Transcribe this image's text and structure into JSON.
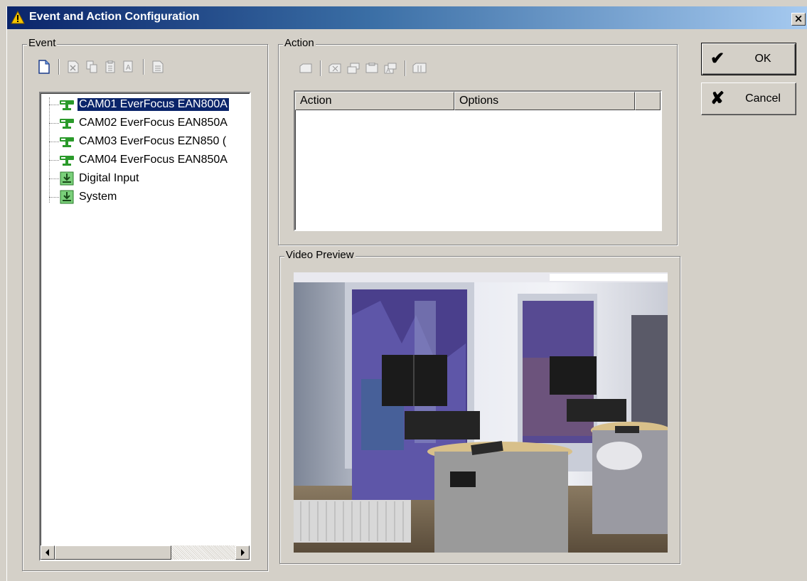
{
  "window": {
    "title": "Event and Action Configuration",
    "close_glyph": "×"
  },
  "event_group": {
    "label": "Event",
    "toolbar": [
      "new-icon",
      "delete-icon",
      "copy-icon",
      "paste-icon",
      "rename-icon",
      "properties-icon"
    ],
    "tree": [
      {
        "label": "CAM01 EverFocus EAN800A",
        "icon": "camera-icon",
        "selected": true
      },
      {
        "label": "CAM02 EverFocus EAN850A",
        "icon": "camera-icon",
        "selected": false
      },
      {
        "label": "CAM03 EverFocus EZN850 (",
        "icon": "camera-icon",
        "selected": false
      },
      {
        "label": "CAM04 EverFocus EAN850A",
        "icon": "camera-icon",
        "selected": false
      },
      {
        "label": "Digital Input",
        "icon": "input-icon",
        "selected": false
      },
      {
        "label": "System",
        "icon": "input-icon",
        "selected": false
      }
    ]
  },
  "action_group": {
    "label": "Action",
    "toolbar": [
      "add-action-icon",
      "remove-action-icon",
      "copy-action-icon",
      "paste-action-icon",
      "edit-action-icon",
      "action-properties-icon"
    ],
    "columns": [
      "Action",
      "Options",
      ""
    ]
  },
  "preview_group": {
    "label": "Video Preview"
  },
  "buttons": {
    "ok": {
      "label": "OK",
      "glyph": "✔"
    },
    "cancel": {
      "label": "Cancel",
      "glyph": "✘"
    }
  },
  "colors": {
    "selection": "#0a246a",
    "titlebar_start": "#0a246a",
    "titlebar_end": "#a6caf0",
    "tree_icon": "#2a9a2a"
  }
}
